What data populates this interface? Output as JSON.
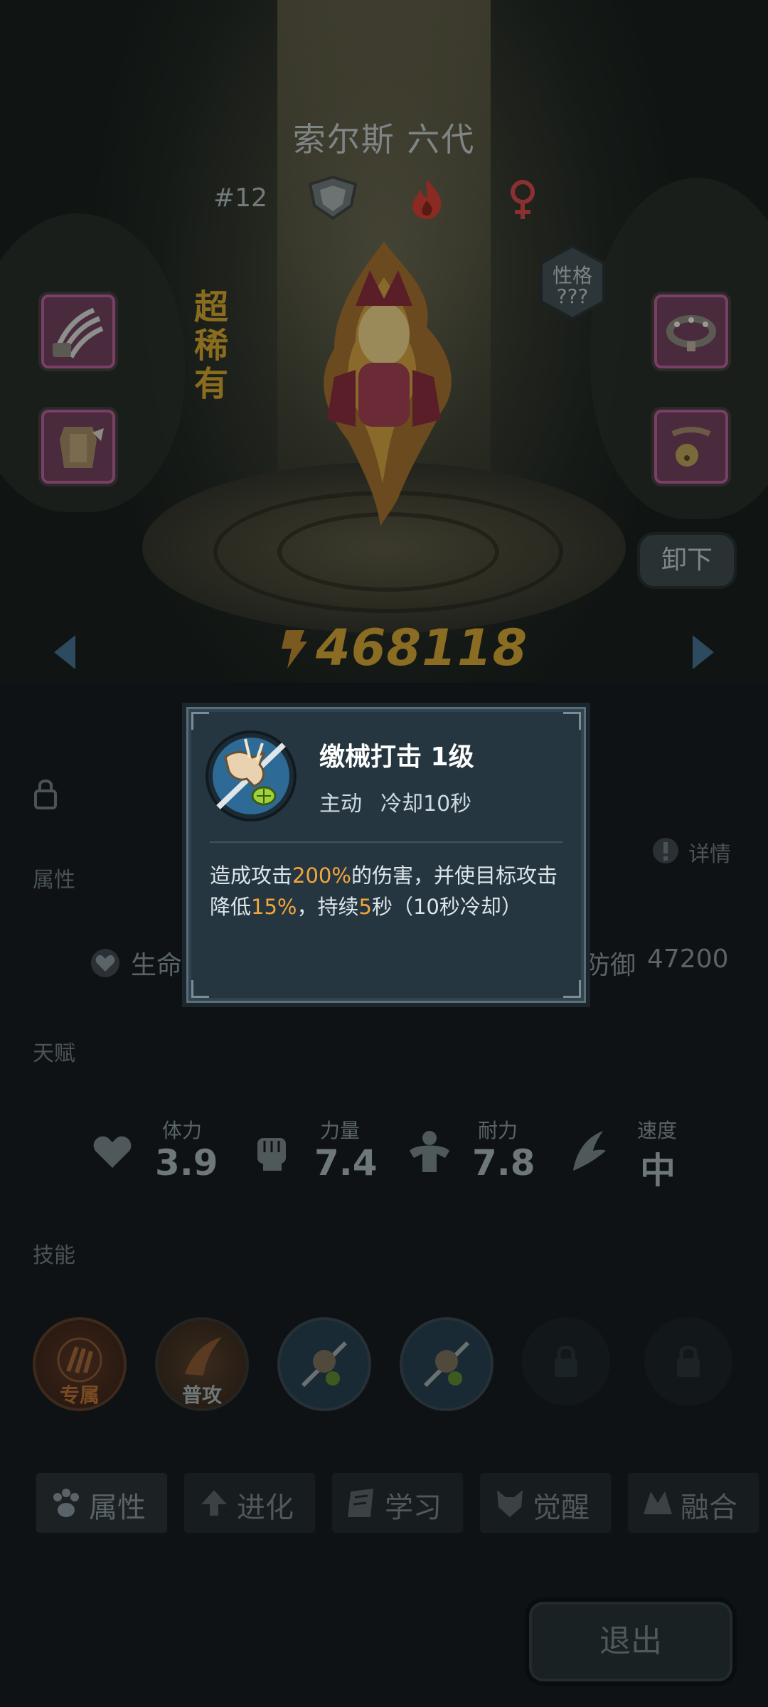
{
  "hero": {
    "name": "索尔斯 六代",
    "rank": "#12",
    "rarity": "超稀有",
    "personality_label": "性格",
    "personality_value": "???",
    "unequip_label": "卸下",
    "power": "468118"
  },
  "page": {
    "detail_label": "详情",
    "attributes_label": "属性",
    "hp_label": "生命",
    "defense_label": "防御",
    "defense_value": "47200",
    "talent_label": "天赋",
    "skills_label": "技能",
    "stats": [
      {
        "label": "体力",
        "value": "3.9"
      },
      {
        "label": "力量",
        "value": "7.4"
      },
      {
        "label": "耐力",
        "value": "7.8"
      },
      {
        "label": "速度",
        "value": "中"
      }
    ],
    "skills": [
      {
        "label": "专属"
      },
      {
        "label": "普攻"
      }
    ],
    "tabs": [
      "属性",
      "进化",
      "学习",
      "觉醒",
      "融合"
    ],
    "exit_label": "退出"
  },
  "popup": {
    "title": "缴械打击 1级",
    "type": "主动",
    "cooldown": "冷却10秒",
    "desc_1": "造成攻击",
    "desc_2": "200%",
    "desc_3": "的伤害，并使目标攻击降低",
    "desc_4": "15%",
    "desc_5": "，持续",
    "desc_6": "5",
    "desc_7": "秒（10秒冷却）"
  },
  "colors": {
    "highlight": "#f3a63a",
    "popup_bg": "#263640"
  }
}
